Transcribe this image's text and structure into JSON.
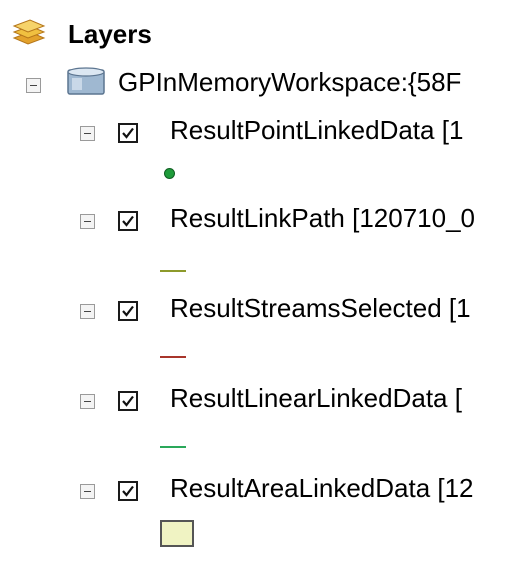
{
  "toc": {
    "root_label": "Layers",
    "workspace": {
      "label": "GPInMemoryWorkspace:{58F",
      "expanded": true
    },
    "layers": [
      {
        "label": "ResultPointLinkedData [1",
        "checked": true,
        "symbol": "point",
        "color": "#1e9b3a"
      },
      {
        "label": "ResultLinkPath [120710_0",
        "checked": true,
        "symbol": "line",
        "color": "#8d9a2b"
      },
      {
        "label": "ResultStreamsSelected [1",
        "checked": true,
        "symbol": "line",
        "color": "#a8352b"
      },
      {
        "label": "ResultLinearLinkedData [",
        "checked": true,
        "symbol": "line",
        "color": "#2aa85a"
      },
      {
        "label": "ResultAreaLinkedData [12",
        "checked": true,
        "symbol": "fill",
        "color": "#f0f3c3"
      }
    ]
  }
}
